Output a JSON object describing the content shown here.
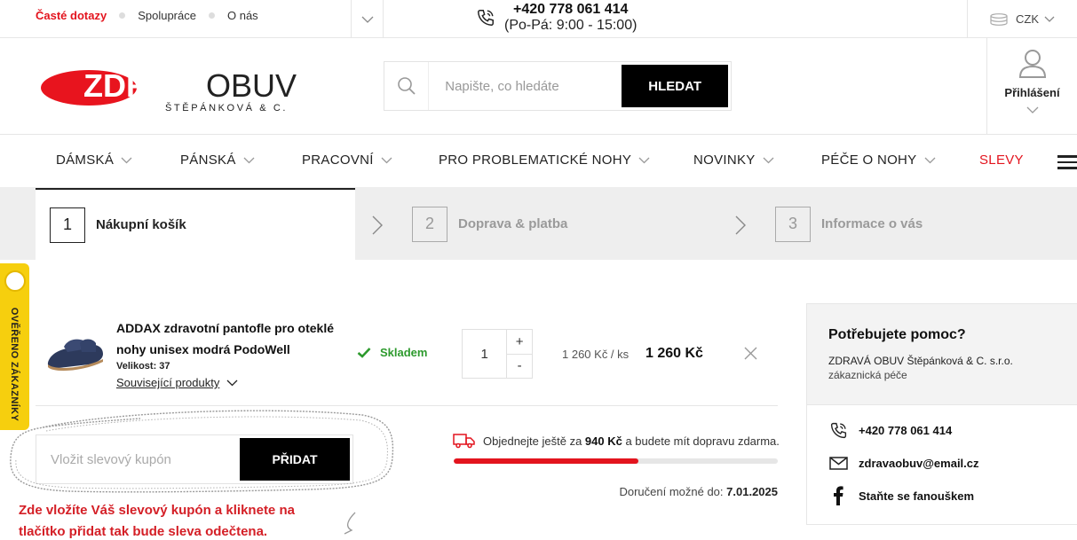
{
  "topbar": {
    "links": [
      "Časté dotazy",
      "Spolupráce",
      "O nás"
    ],
    "phone": "+420 778 061 414",
    "hours": "(Po-Pá: 9:00 - 15:00)",
    "currency": "CZK"
  },
  "header": {
    "logo_main_bold": "ZDRAVÁ",
    "logo_main_light": "OBUV",
    "logo_sub": "ŠTĚPÁNKOVÁ & C.",
    "search_placeholder": "Napište, co hledáte",
    "search_button": "HLEDAT",
    "login_label": "Přihlášení"
  },
  "nav": [
    {
      "label": "DÁMSKÁ"
    },
    {
      "label": "PÁNSKÁ"
    },
    {
      "label": "PRACOVNÍ"
    },
    {
      "label": "PRO PROBLEMATICKÉ NOHY"
    },
    {
      "label": "NOVINKY"
    },
    {
      "label": "PÉČE O NOHY"
    },
    {
      "label": "SLEVY"
    }
  ],
  "steps": [
    {
      "num": "1",
      "label": "Nákupní košík"
    },
    {
      "num": "2",
      "label": "Doprava & platba"
    },
    {
      "num": "3",
      "label": "Informace o vás"
    }
  ],
  "cart": {
    "product_name": "ADDAX zdravotní pantofle pro oteklé nohy unisex modrá PodoWell",
    "size": "Velikost: 37",
    "related": "Související produkty",
    "stock": "Skladem",
    "quantity": "1",
    "plus": "+",
    "minus": "-",
    "unit_price": "1 260 Kč / ks",
    "total_price": "1 260 Kč"
  },
  "coupon": {
    "placeholder": "Vložit slevový kupón",
    "button": "PŘIDAT",
    "note": "Zde vložíte Váš slevový kupón a kliknete na tlačítko přidat tak bude sleva odečtena."
  },
  "shipping": {
    "text_before": "Objednejte ještě za",
    "amount": "940 Kč",
    "text_after": "a budete mít dopravu zdarma.",
    "progress_fraction": 0.57,
    "delivery_label": "Doručení možné do:",
    "delivery_date": "7.01.2025"
  },
  "help": {
    "title": "Potřebujete pomoc?",
    "company": "ZDRAVÁ OBUV Štěpánková & C. s.r.o.",
    "subtitle": "zákaznická péče",
    "phone": "+420 778 061 414",
    "email": "zdravaobuv@email.cz",
    "facebook": "Staňte se fanouškem"
  },
  "badge": {
    "text": "OVĚŘENO ZÁKAZNÍKY"
  },
  "colors": {
    "brand_red": "#e3141e",
    "stock_green": "#2d9a2d",
    "badge_yellow": "#f6cf0e"
  }
}
